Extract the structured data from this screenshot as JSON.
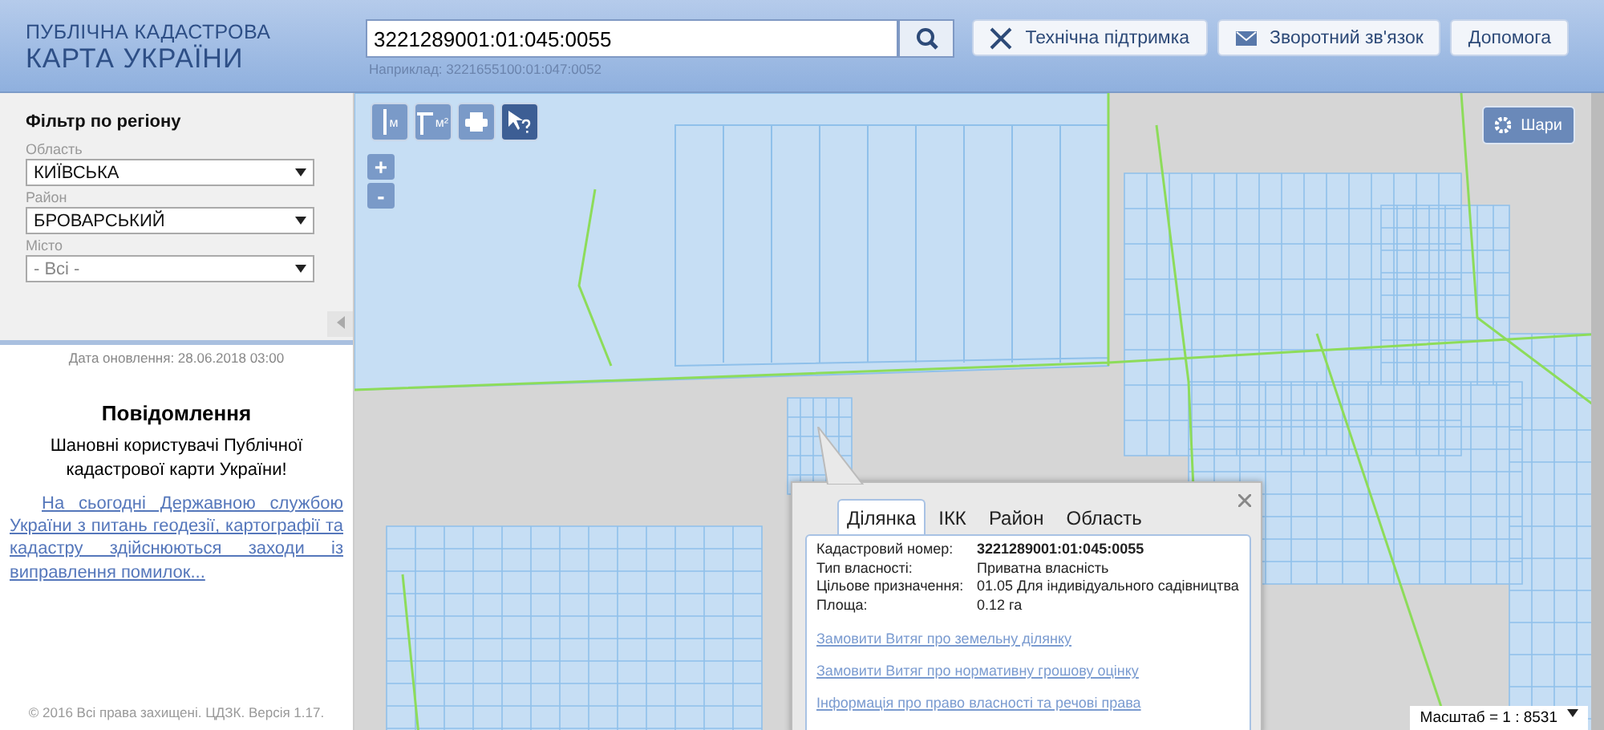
{
  "header": {
    "title_top": "ПУБЛІЧНА КАДАСТРОВА",
    "title_bottom": "КАРТА УКРАЇНИ",
    "search": {
      "value": "3221289001:01:045:0055",
      "example": "Наприклад: 3221655100:01:047:0052"
    },
    "buttons": [
      {
        "kind": "support",
        "label": "Технічна підтримка"
      },
      {
        "kind": "feedback",
        "label": "Зворотний зв'язок"
      },
      {
        "kind": "help",
        "label": "Допомога"
      }
    ]
  },
  "filter": {
    "title": "Фільтр по регіону",
    "fields": [
      {
        "label": "Область",
        "value": "КИЇВСЬКА"
      },
      {
        "label": "Район",
        "value": "БРОВАРСЬКИЙ"
      },
      {
        "label": "Місто",
        "placeholder": "- Всі -"
      }
    ]
  },
  "update_date": "Дата оновлення: 28.06.2018 03:00",
  "notice": {
    "title": "Повідомлення",
    "greeting": "Шановні користувачі Публічної кадастрової карти України!",
    "link": "На сьогодні Державною службою України з питань геодезії, картографії та кадастру здійснюються заходи із виправлення помилок..."
  },
  "footer": "© 2016 Всі права захищені. ЦДЗК. Версія 1.17.",
  "map_tools": [
    {
      "kind": "distance",
      "label": "м",
      "selected": false
    },
    {
      "kind": "area",
      "label": "м²",
      "selected": false
    },
    {
      "kind": "print",
      "selected": false
    },
    {
      "kind": "query",
      "selected": true
    }
  ],
  "zoom": [
    "+",
    "-"
  ],
  "layers_button": "Шари",
  "popup": {
    "tabs": [
      {
        "label": "Ділянка",
        "selected": true
      },
      {
        "label": "ІКК",
        "selected": false
      },
      {
        "label": "Район",
        "selected": false
      },
      {
        "label": "Область",
        "selected": false
      }
    ],
    "rows": [
      {
        "label": "Кадастровий номер:",
        "value": "3221289001:01:045:0055",
        "bold": true
      },
      {
        "label": "Тип власності:",
        "value": "Приватна власність",
        "bold": false
      },
      {
        "label": "Цільове призначення:",
        "value": "01.05 Для індивідуального садівництва",
        "bold": false
      },
      {
        "label": "Площа:",
        "value": "0.12 га",
        "bold": false
      }
    ],
    "links": [
      "Замовити Витяг про земельну ділянку",
      "Замовити Витяг про нормативну грошову оцінку",
      "Інформація про право власності та речові права"
    ]
  },
  "scale": "Масштаб = 1 : 8531"
}
